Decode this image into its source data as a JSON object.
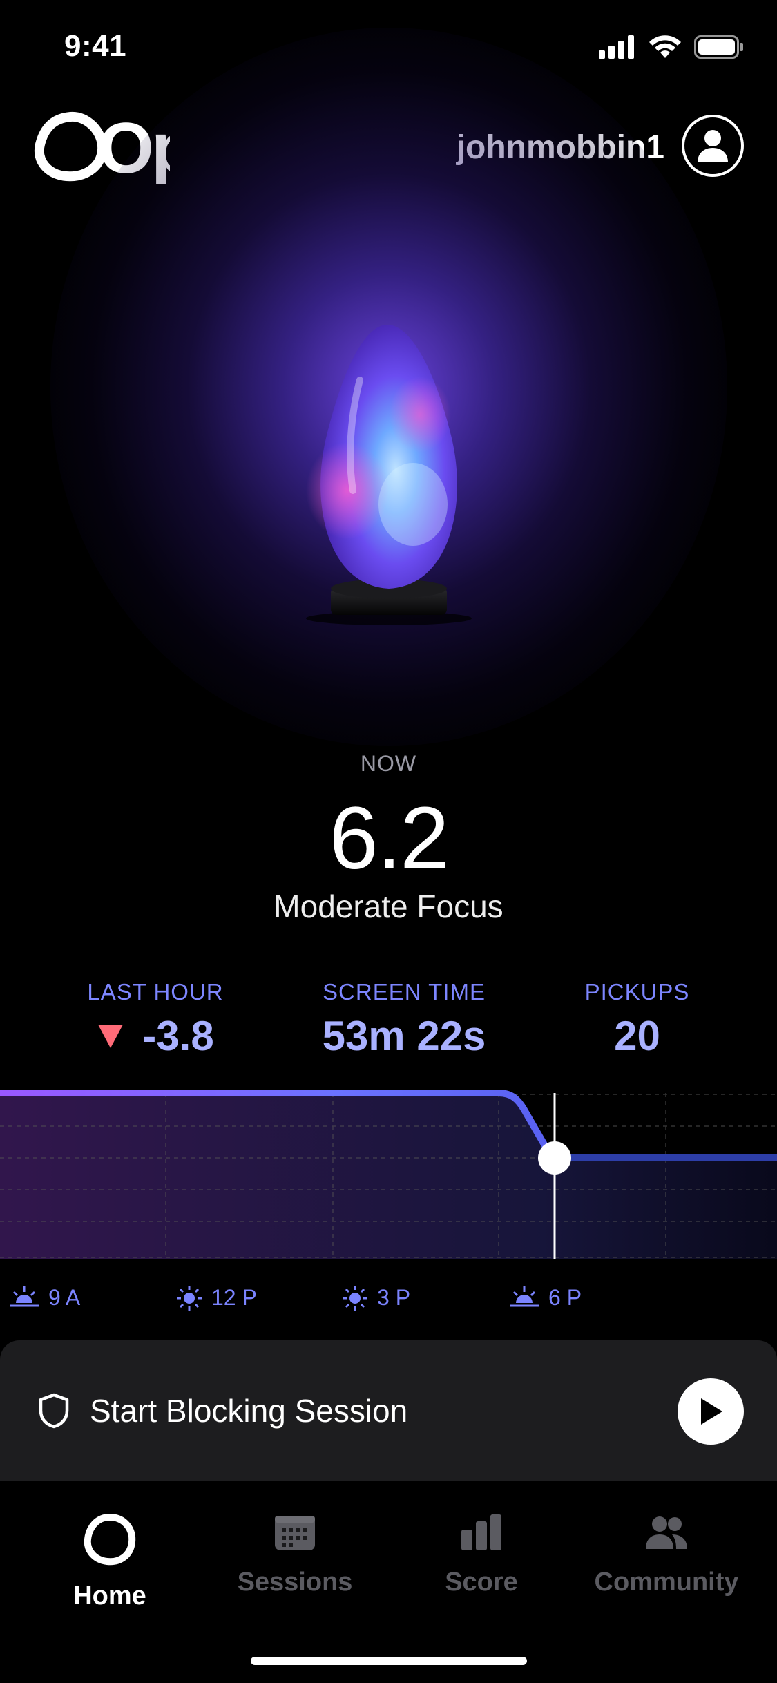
{
  "status_bar": {
    "time": "9:41"
  },
  "header": {
    "logo": "Opal",
    "username": "johnmobbin1"
  },
  "focus": {
    "label": "NOW",
    "score": "6.2",
    "description": "Moderate Focus"
  },
  "stats": [
    {
      "label": "LAST HOUR",
      "value": "-3.8",
      "trend": "down"
    },
    {
      "label": "SCREEN TIME",
      "value": "53m 22s"
    },
    {
      "label": "PICKUPS",
      "value": "20"
    }
  ],
  "time_axis": [
    {
      "label": "9 A",
      "icon": "sunrise-icon"
    },
    {
      "label": "12 P",
      "icon": "sun-icon"
    },
    {
      "label": "3 P",
      "icon": "sun-icon"
    },
    {
      "label": "6 P",
      "icon": "sunset-icon"
    }
  ],
  "blocking": {
    "label": "Start Blocking Session"
  },
  "tabs": [
    {
      "label": "Home",
      "icon": "opal-icon",
      "active": true
    },
    {
      "label": "Sessions",
      "icon": "calendar-icon",
      "active": false
    },
    {
      "label": "Score",
      "icon": "bar-chart-icon",
      "active": false
    },
    {
      "label": "Community",
      "icon": "people-icon",
      "active": false
    }
  ],
  "colors": {
    "accent": "#7b84ff",
    "stat_value": "#a9b1ff",
    "trend_down": "#ff6b78",
    "card": "#1d1d1f"
  }
}
